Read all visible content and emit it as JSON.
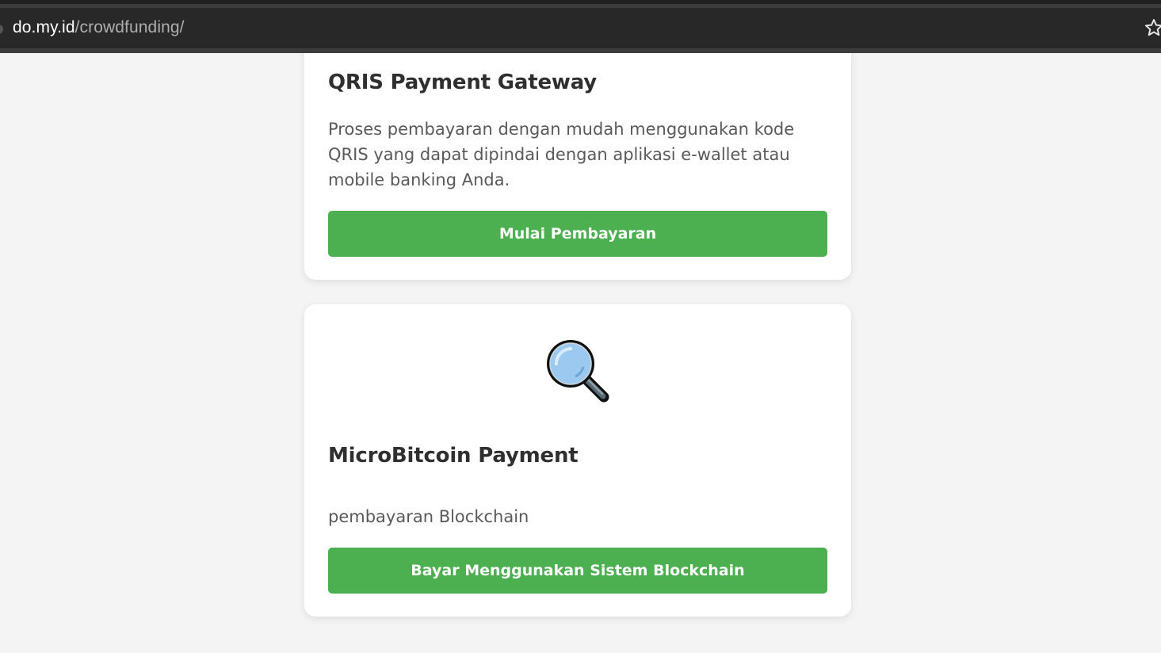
{
  "browser": {
    "url_host": "do.my.id",
    "url_path": "/crowdfunding/",
    "bookmark_icon": "star-icon"
  },
  "cards": [
    {
      "title": "QRIS Payment Gateway",
      "description": "Proses pembayaran dengan mudah menggunakan kode QRIS yang dapat dipindai dengan aplikasi e-wallet atau mobile banking Anda.",
      "button_label": "Mulai Pembayaran"
    },
    {
      "icon": "magnifier-icon",
      "title": "MicroBitcoin Payment",
      "description": "pembayaran Blockchain",
      "button_label": "Bayar Menggunakan Sistem Blockchain"
    }
  ],
  "colors": {
    "button_green": "#4caf50",
    "page_background": "#f4f4f4",
    "card_background": "#ffffff"
  }
}
